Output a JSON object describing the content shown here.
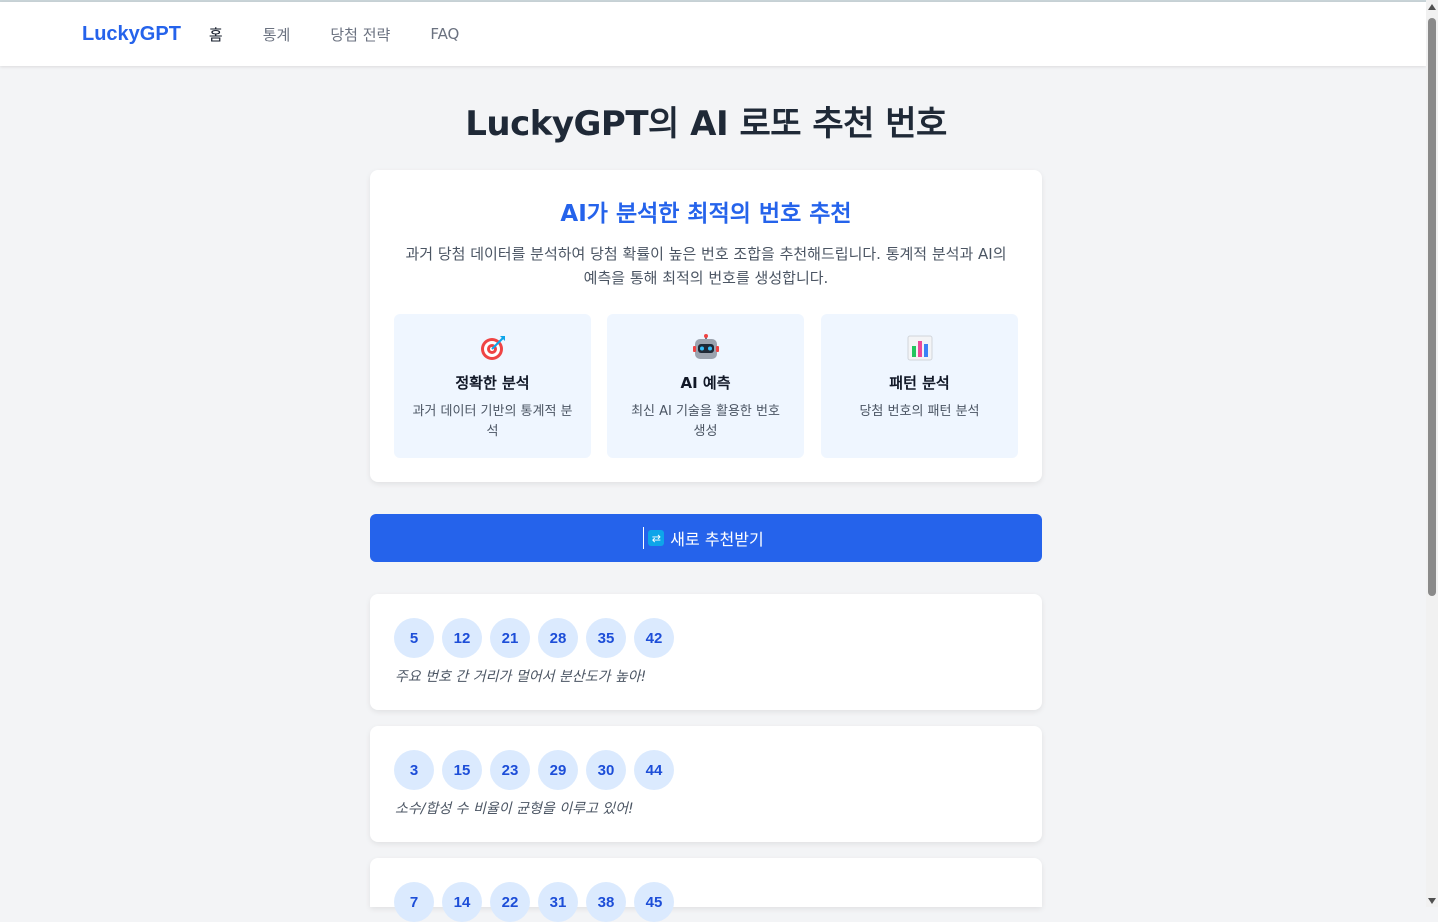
{
  "nav": {
    "brand": "LuckyGPT",
    "links": [
      "홈",
      "통계",
      "당첨 전략",
      "FAQ"
    ]
  },
  "page_title": "LuckyGPT의 AI 로또 추천 번호",
  "intro": {
    "heading": "AI가 분석한 최적의 번호 추천",
    "description": "과거 당첨 데이터를 분석하여 당첨 확률이 높은 번호 조합을 추천해드립니다. 통계적 분석과 AI의 예측을 통해 최적의 번호를 생성합니다.",
    "features": [
      {
        "icon": "target-icon",
        "title": "정확한 분석",
        "desc": "과거 데이터 기반의 통계적 분석"
      },
      {
        "icon": "robot-icon",
        "title": "AI 예측",
        "desc": "최신 AI 기술을 활용한 번호 생성"
      },
      {
        "icon": "bar-chart-icon",
        "title": "패턴 분석",
        "desc": "당첨 번호의 패턴 분석"
      }
    ]
  },
  "refresh_button": {
    "label": "새로 추천받기",
    "icon": "refresh-icon"
  },
  "combinations": [
    {
      "numbers": [
        "5",
        "12",
        "21",
        "28",
        "35",
        "42"
      ],
      "note": "주요 번호 간 거리가 멀어서 분산도가 높아!"
    },
    {
      "numbers": [
        "3",
        "15",
        "23",
        "29",
        "30",
        "44"
      ],
      "note": "소수/합성 수 비율이 균형을 이루고 있어!"
    },
    {
      "numbers": [
        "7",
        "14",
        "22",
        "31",
        "38",
        "45"
      ],
      "note": ""
    }
  ],
  "colors": {
    "accent": "#2563eb",
    "ball_bg": "#dbeafe",
    "feature_bg": "#eff6ff",
    "page_bg": "#f3f4f6"
  }
}
